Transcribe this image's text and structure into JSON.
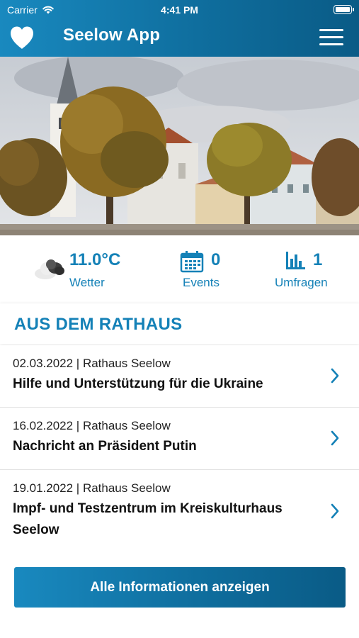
{
  "status_bar": {
    "carrier": "Carrier",
    "time": "4:41 PM"
  },
  "header": {
    "title": "Seelow App"
  },
  "stats": {
    "weather": {
      "value": "11.0°C",
      "label": "Wetter",
      "icon": "cloud-icon"
    },
    "events": {
      "value": "0",
      "label": "Events",
      "icon": "calendar-icon"
    },
    "polls": {
      "value": "1",
      "label": "Umfragen",
      "icon": "bar-chart-icon"
    }
  },
  "section": {
    "title": "AUS DEM RATHAUS"
  },
  "news": [
    {
      "meta": "02.03.2022 | Rathaus Seelow",
      "title": "Hilfe und Unterstützung für die Ukraine"
    },
    {
      "meta": "16.02.2022 | Rathaus Seelow",
      "title": "Nachricht an Präsident Putin"
    },
    {
      "meta": "19.01.2022 | Rathaus Seelow",
      "title": "Impf- und Testzentrum im Kreiskulturhaus Seelow"
    }
  ],
  "cta": {
    "label": "Alle Informationen anzeigen"
  },
  "colors": {
    "brand": "#1481b7",
    "header_start": "#1989bf",
    "header_end": "#0a5b86"
  }
}
